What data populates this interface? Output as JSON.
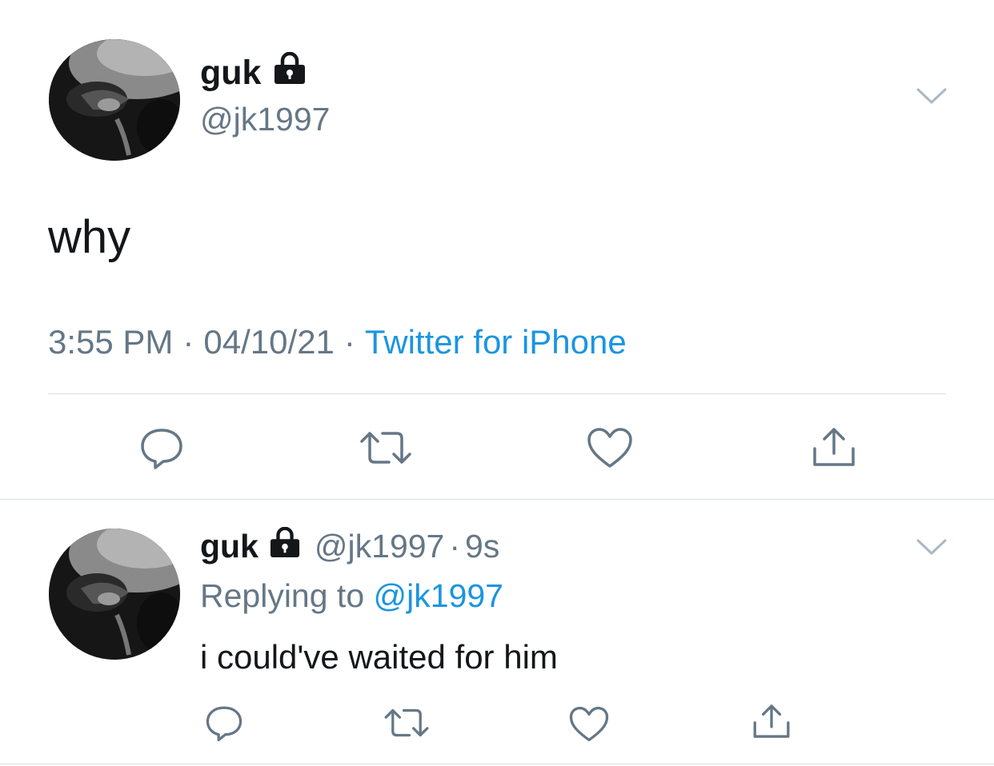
{
  "main_tweet": {
    "display_name": "guk",
    "handle": "@jk1997",
    "text": "why",
    "time": "3:55 PM",
    "date": "04/10/21",
    "separator": "·",
    "source": "Twitter for iPhone",
    "locked_icon": "lock-icon",
    "actions": [
      "reply-icon",
      "retweet-icon",
      "like-icon",
      "share-icon"
    ]
  },
  "reply_tweet": {
    "display_name": "guk",
    "handle": "@jk1997",
    "separator": "·",
    "time_ago": "9s",
    "replying_label": "Replying to",
    "replying_to": "@jk1997",
    "text": "i could've waited for him",
    "locked_icon": "lock-icon",
    "actions": [
      "reply-icon",
      "retweet-icon",
      "like-icon",
      "share-icon"
    ]
  },
  "colors": {
    "text": "#14171a",
    "secondary": "#657786",
    "link": "#1b95e0",
    "divider": "#d8dde2"
  }
}
